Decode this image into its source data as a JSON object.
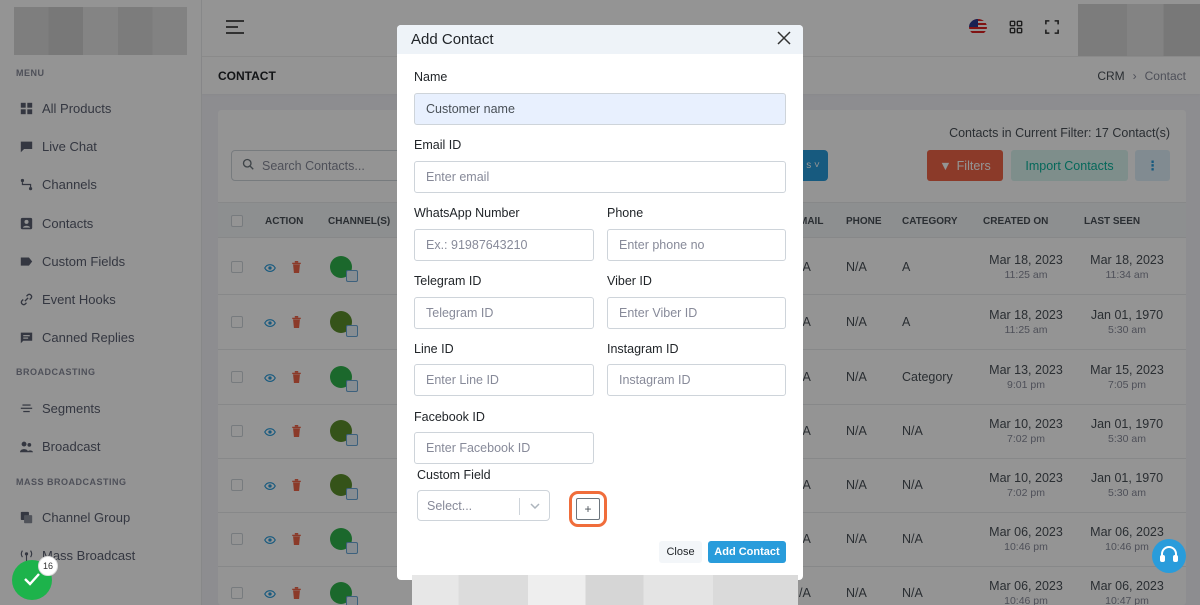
{
  "sidebar": {
    "sections": {
      "menu": "MENU",
      "broadcasting": "BROADCASTING",
      "mass_broadcasting": "MASS BROADCASTING"
    },
    "items": [
      {
        "label": "All Products",
        "icon": "grid-icon"
      },
      {
        "label": "Live Chat",
        "icon": "chat-icon"
      },
      {
        "label": "Channels",
        "icon": "route-icon"
      },
      {
        "label": "Contacts",
        "icon": "contact-card-icon"
      },
      {
        "label": "Custom Fields",
        "icon": "tag-icon"
      },
      {
        "label": "Event Hooks",
        "icon": "link-icon"
      },
      {
        "label": "Canned Replies",
        "icon": "message-icon"
      },
      {
        "label": "Segments",
        "icon": "segments-icon"
      },
      {
        "label": "Broadcast",
        "icon": "broadcast-users-icon"
      },
      {
        "label": "Channel Group",
        "icon": "channel-group-icon"
      },
      {
        "label": "Mass Broadcast",
        "icon": "antenna-icon"
      }
    ]
  },
  "page": {
    "title": "CONTACT",
    "breadcrumb": [
      "CRM",
      "Contact"
    ],
    "filter_count": "Contacts in Current Filter: 17 Contact(s)",
    "search_placeholder": "Search Contacts...",
    "filters_label": "Filters",
    "import_label": "Import Contacts",
    "more_label": "⋮",
    "hidden_btn_label": "s ˅"
  },
  "table": {
    "headers": [
      "ACTION",
      "CHANNEL(S)",
      "MAIL",
      "PHONE",
      "CATEGORY",
      "CREATED ON",
      "LAST SEEN"
    ],
    "rows": [
      {
        "mail": "/A",
        "phone": "N/A",
        "category": "A",
        "created_d": "Mar 18, 2023",
        "created_t": "11:25 am",
        "seen_d": "Mar 18, 2023",
        "seen_t": "11:34 am"
      },
      {
        "mail": "/A",
        "phone": "N/A",
        "category": "A",
        "created_d": "Mar 18, 2023",
        "created_t": "11:25 am",
        "seen_d": "Jan 01, 1970",
        "seen_t": "5:30 am"
      },
      {
        "mail": "/A",
        "phone": "N/A",
        "category": "Category",
        "created_d": "Mar 13, 2023",
        "created_t": "9:01 pm",
        "seen_d": "Mar 15, 2023",
        "seen_t": "7:05 pm"
      },
      {
        "mail": "/A",
        "phone": "N/A",
        "category": "N/A",
        "created_d": "Mar 10, 2023",
        "created_t": "7:02 pm",
        "seen_d": "Jan 01, 1970",
        "seen_t": "5:30 am"
      },
      {
        "mail": "/A",
        "phone": "N/A",
        "category": "N/A",
        "created_d": "Mar 10, 2023",
        "created_t": "7:02 pm",
        "seen_d": "Jan 01, 1970",
        "seen_t": "5:30 am"
      },
      {
        "mail": "/A",
        "phone": "N/A",
        "category": "N/A",
        "created_d": "Mar 06, 2023",
        "created_t": "10:46 pm",
        "seen_d": "Mar 06, 2023",
        "seen_t": "10:46 pm"
      },
      {
        "mail": "/A",
        "phone": "N/A",
        "category": "N/A",
        "created_d": "Mar 06, 2023",
        "created_t": "10:46 pm",
        "seen_d": "Mar 06, 2023",
        "seen_t": "10:47 pm"
      }
    ]
  },
  "modal": {
    "title": "Add Contact",
    "name_label": "Name",
    "name_value": "Customer name",
    "email_label": "Email ID",
    "email_placeholder": "Enter email",
    "whatsapp_label": "WhatsApp Number",
    "whatsapp_placeholder": "Ex.: 91987643210",
    "phone_label": "Phone",
    "phone_placeholder": "Enter phone no",
    "telegram_label": "Telegram ID",
    "telegram_placeholder": "Telegram ID",
    "viber_label": "Viber ID",
    "viber_placeholder": "Enter Viber ID",
    "line_label": "Line ID",
    "line_placeholder": "Enter Line ID",
    "instagram_label": "Instagram ID",
    "instagram_placeholder": "Instagram ID",
    "facebook_label": "Facebook ID",
    "facebook_placeholder": "Enter Facebook ID",
    "custom_field_label": "Custom Field",
    "custom_field_select": "Select...",
    "plus_label": "+",
    "close_label": "Close",
    "add_label": "Add Contact"
  },
  "fab_badge": "16",
  "colors": {
    "primary": "#299cdb",
    "danger": "#f06548",
    "success": "#0ab39c",
    "highlight": "#f06d3b"
  }
}
